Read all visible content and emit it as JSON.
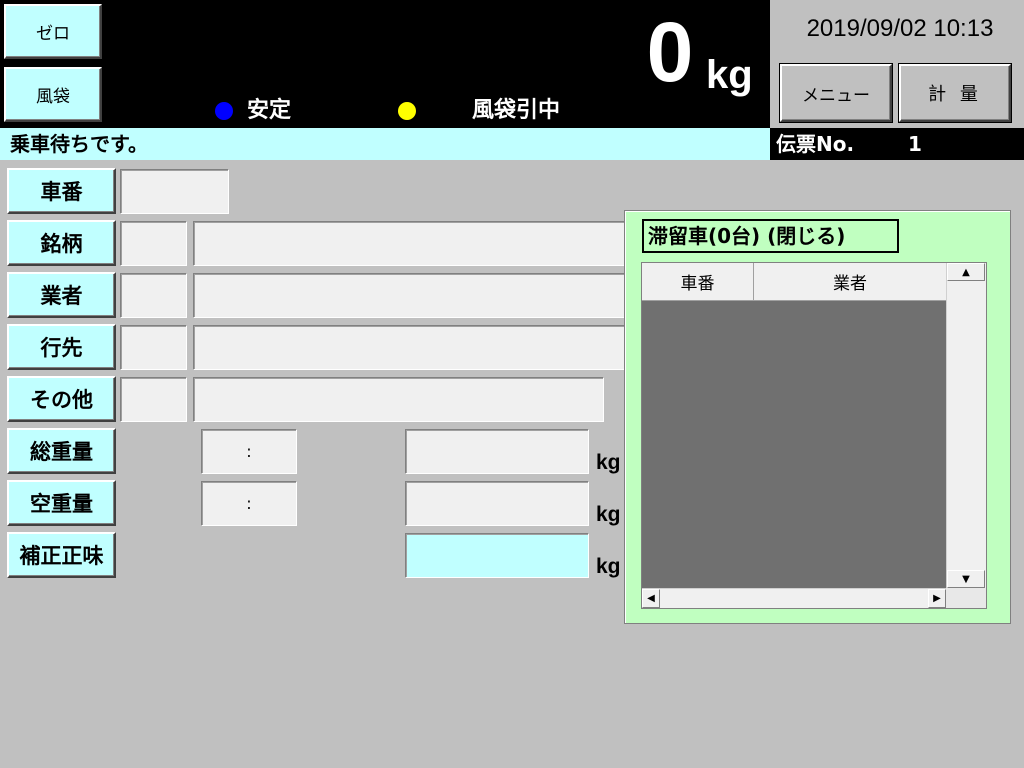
{
  "header": {
    "zero_button": "ゼロ",
    "bag_button": "風袋",
    "weight_value": "0",
    "weight_unit": "kg",
    "status_stable": "安定",
    "status_stable_color": "#0000ff",
    "status_bag": "風袋引中",
    "status_bag_color": "#ffff00",
    "datetime": "2019/09/02 10:13",
    "menu_button": "メニュー",
    "measure_button": "計 量"
  },
  "message_bar": {
    "message": "乗車待ちです。",
    "slip_label": "伝票No.",
    "slip_number": "1"
  },
  "form": {
    "vehicle_no_label": "車番",
    "brand_label": "銘柄",
    "vendor_label": "業者",
    "destination_label": "行先",
    "other_label": "その他",
    "gross_weight_label": "総重量",
    "gross_time": ":",
    "gross_unit": "kg",
    "empty_weight_label": "空重量",
    "empty_time": ":",
    "empty_unit": "kg",
    "correction_label": "補正正味",
    "correction_unit": "kg"
  },
  "parked_panel": {
    "title": "滞留車(0台) (閉じる)",
    "columns": [
      "車番",
      "業者"
    ]
  },
  "colors": {
    "cyan": "#c0ffff",
    "panel_green": "#c0ffc0",
    "background": "#c0c0c0"
  }
}
